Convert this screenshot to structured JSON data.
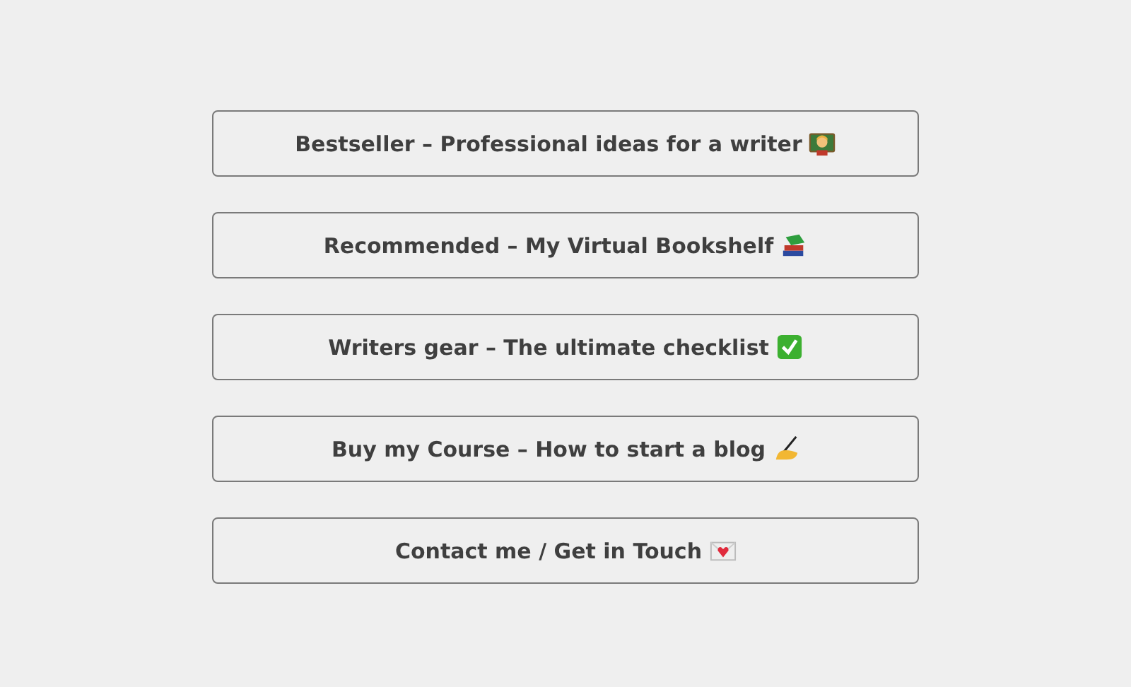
{
  "links": [
    {
      "label": "Bestseller – Professional ideas for a writer"
    },
    {
      "label": "Recommended – My Virtual Bookshelf"
    },
    {
      "label": "Writers gear – The ultimate checklist"
    },
    {
      "label": "Buy my Course – How to start a blog"
    },
    {
      "label": "Contact me / Get in Touch"
    }
  ]
}
